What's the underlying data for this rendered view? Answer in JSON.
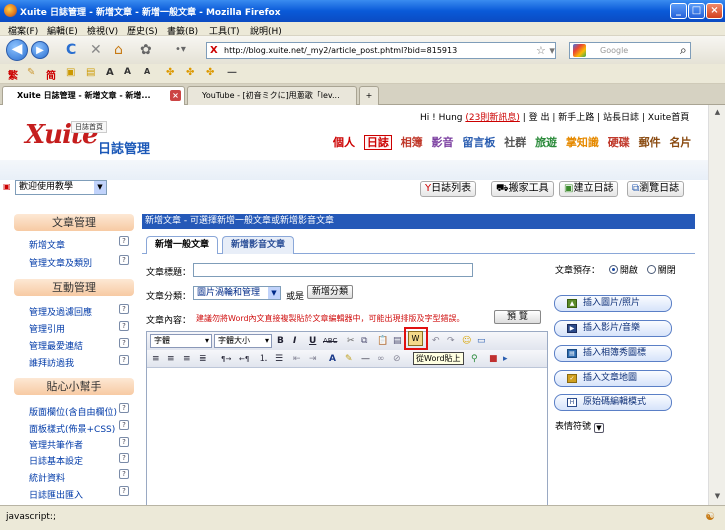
{
  "window": {
    "title": "Xuite 日誌管理 - 新增文章 - 新增一般文章 - Mozilla Firefox"
  },
  "menu": [
    "檔案(F)",
    "編輯(E)",
    "檢視(V)",
    "歷史(S)",
    "書籤(B)",
    "工具(T)",
    "說明(H)"
  ],
  "nav": {
    "url": "http://blog.xuite.net/_my2/article_post.phtml?bid=815913",
    "search_placeholder": "Google"
  },
  "bookmarks": [
    "繁",
    "简",
    "A",
    "A",
    "A"
  ],
  "browser_tabs": [
    {
      "label": "Xuite 日誌管理 - 新增文章 - 新增..."
    },
    {
      "label": "YouTube - [初音ミクに]甩蔥歌「lev..."
    }
  ],
  "site": {
    "top_links": {
      "greeting": "Hi ! Hung",
      "new_messages": "(23則新訊息)",
      "logout": "登 出",
      "newbie": "新手上路",
      "site_blog": "站長日誌",
      "home": "Xuite首頁"
    },
    "logo_text": "Xuite",
    "logo_sub": "日誌管理",
    "logo_home": "日誌首頁",
    "channels": [
      "個人",
      "日誌",
      "相簿",
      "影音",
      "留言板",
      "社群",
      "旅遊",
      "掌知識",
      "硬碟",
      "郵件",
      "名片"
    ],
    "help_select": "歡迎使用教學",
    "blog_buttons": [
      "日誌列表",
      "搬家工具",
      "建立日誌",
      "瀏覽日誌"
    ]
  },
  "sidebar": {
    "sections": [
      {
        "title": "文章管理",
        "items": [
          "新增文章",
          "管理文章及類別"
        ]
      },
      {
        "title": "互動管理",
        "items": [
          "管理及過濾回應",
          "管理引用",
          "管理最愛連結",
          "誰拜訪過我"
        ]
      },
      {
        "title": "貼心小幫手",
        "items": [
          "版面欄位(含自由欄位)",
          "面板樣式(佈景+CSS)",
          "管理共筆作者",
          "日誌基本設定",
          "統計資料",
          "日誌匯出匯入"
        ]
      }
    ],
    "help_mark": "?"
  },
  "main": {
    "header": "新增文章 - 可選擇新增一般文章或新增影音文章",
    "tabs": [
      "新增一般文章",
      "新增影音文章"
    ],
    "title_label": "文章標題：",
    "category_label": "文章分類：",
    "category_value": "圖片渦輪和管理",
    "or_label": "或是",
    "new_category_button": "新增分類",
    "content_label": "文章內容：",
    "warning": "建議勿將Word內文直接複製貼於文章編輯器中，可能出現排版及字型錯誤。",
    "preview_button": "預 覽",
    "editor": {
      "font_select": "字體",
      "size_select": "字體大小",
      "tooltip": "從Word貼上"
    },
    "preview": {
      "label": "文章預存：",
      "on": "開啟",
      "off": "關閉"
    },
    "insert_buttons": [
      "插入圖片/照片",
      "插入影片/音樂",
      "插入相簿秀圖標",
      "插入文章地圖",
      "原始碼編輯模式"
    ],
    "emoji_label": "表情符號"
  },
  "status": "javascript:;"
}
